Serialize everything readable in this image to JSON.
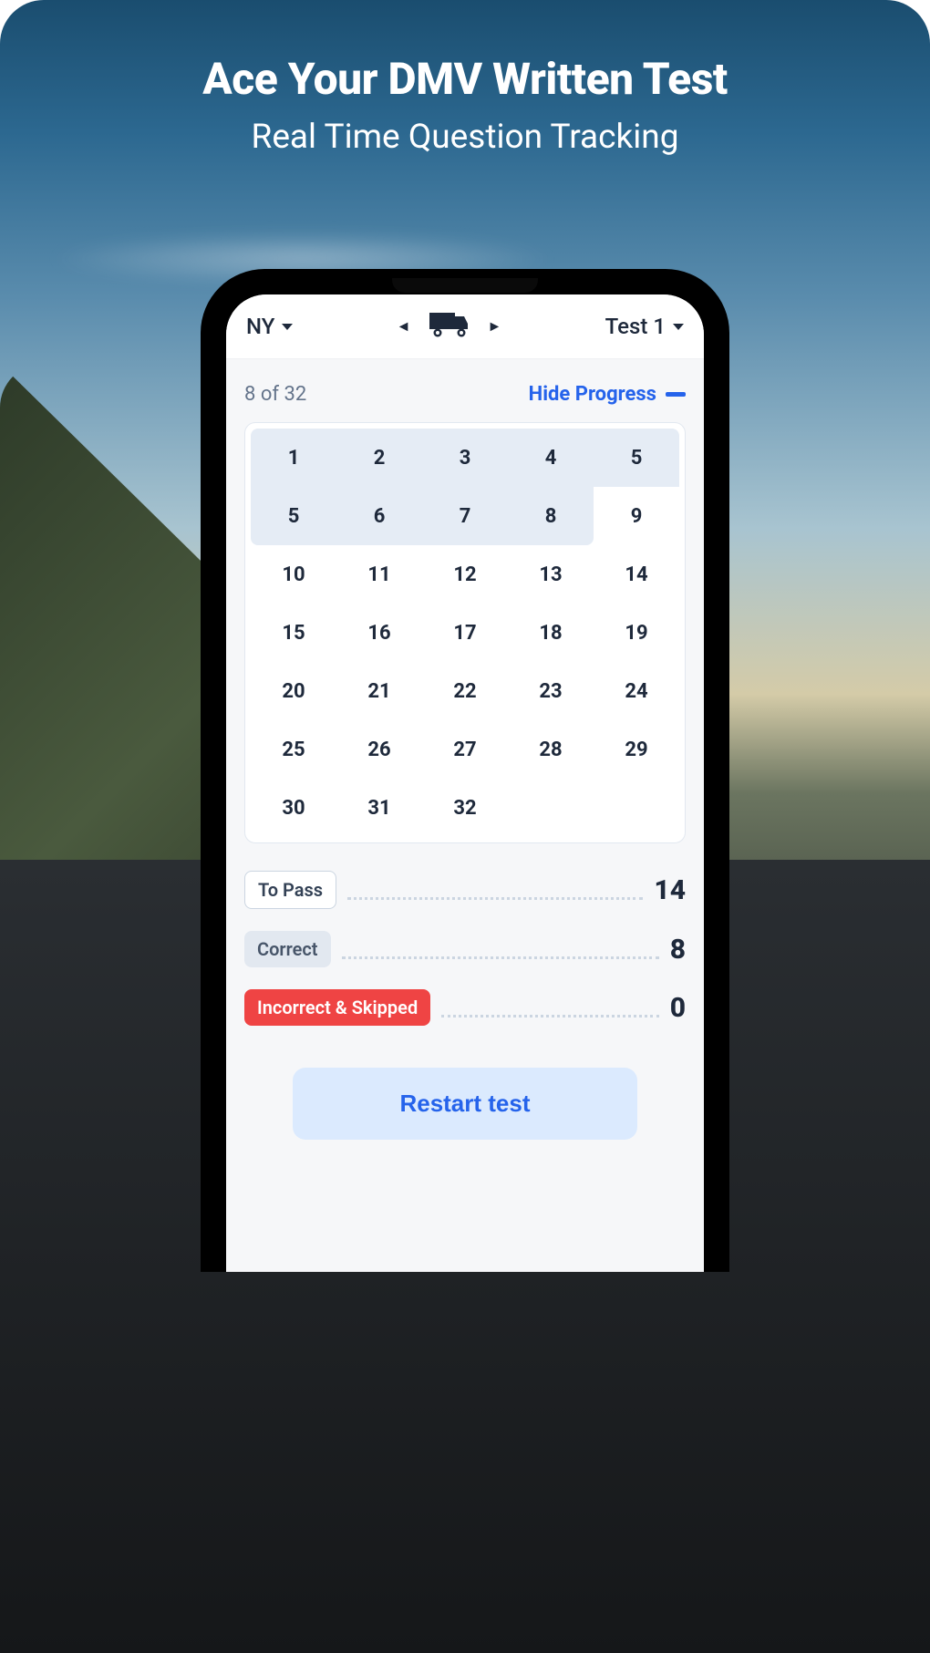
{
  "hero": {
    "title": "Ace Your DMV Written Test",
    "subtitle": "Real Time Question Tracking"
  },
  "header": {
    "state": "NY",
    "test": "Test 1"
  },
  "progress": {
    "current": 8,
    "total": 32,
    "text": "8 of 32",
    "hide_label": "Hide Progress"
  },
  "questions": [
    {
      "n": "1",
      "answered": true,
      "corner": "tl"
    },
    {
      "n": "2",
      "answered": true
    },
    {
      "n": "3",
      "answered": true
    },
    {
      "n": "4",
      "answered": true
    },
    {
      "n": "5",
      "answered": true,
      "corner": "tr"
    },
    {
      "n": "5",
      "answered": true,
      "corner": "bl"
    },
    {
      "n": "6",
      "answered": true
    },
    {
      "n": "7",
      "answered": true
    },
    {
      "n": "8",
      "answered": true,
      "corner": "br"
    },
    {
      "n": "9",
      "answered": false
    },
    {
      "n": "10",
      "answered": false
    },
    {
      "n": "11",
      "answered": false
    },
    {
      "n": "12",
      "answered": false
    },
    {
      "n": "13",
      "answered": false
    },
    {
      "n": "14",
      "answered": false
    },
    {
      "n": "15",
      "answered": false
    },
    {
      "n": "16",
      "answered": false
    },
    {
      "n": "17",
      "answered": false
    },
    {
      "n": "18",
      "answered": false
    },
    {
      "n": "19",
      "answered": false
    },
    {
      "n": "20",
      "answered": false
    },
    {
      "n": "21",
      "answered": false
    },
    {
      "n": "22",
      "answered": false
    },
    {
      "n": "23",
      "answered": false
    },
    {
      "n": "24",
      "answered": false
    },
    {
      "n": "25",
      "answered": false
    },
    {
      "n": "26",
      "answered": false
    },
    {
      "n": "27",
      "answered": false
    },
    {
      "n": "28",
      "answered": false
    },
    {
      "n": "29",
      "answered": false
    },
    {
      "n": "30",
      "answered": false
    },
    {
      "n": "31",
      "answered": false
    },
    {
      "n": "32",
      "answered": false
    }
  ],
  "stats": {
    "to_pass": {
      "label": "To Pass",
      "value": "14"
    },
    "correct": {
      "label": "Correct",
      "value": "8"
    },
    "incorrect": {
      "label": "Incorrect & Skipped",
      "value": "0"
    }
  },
  "restart_label": "Restart test",
  "icons": {
    "truck": "truck-icon",
    "caret_down": "caret-down-icon",
    "left_arrow": "◄",
    "right_arrow": "►"
  }
}
